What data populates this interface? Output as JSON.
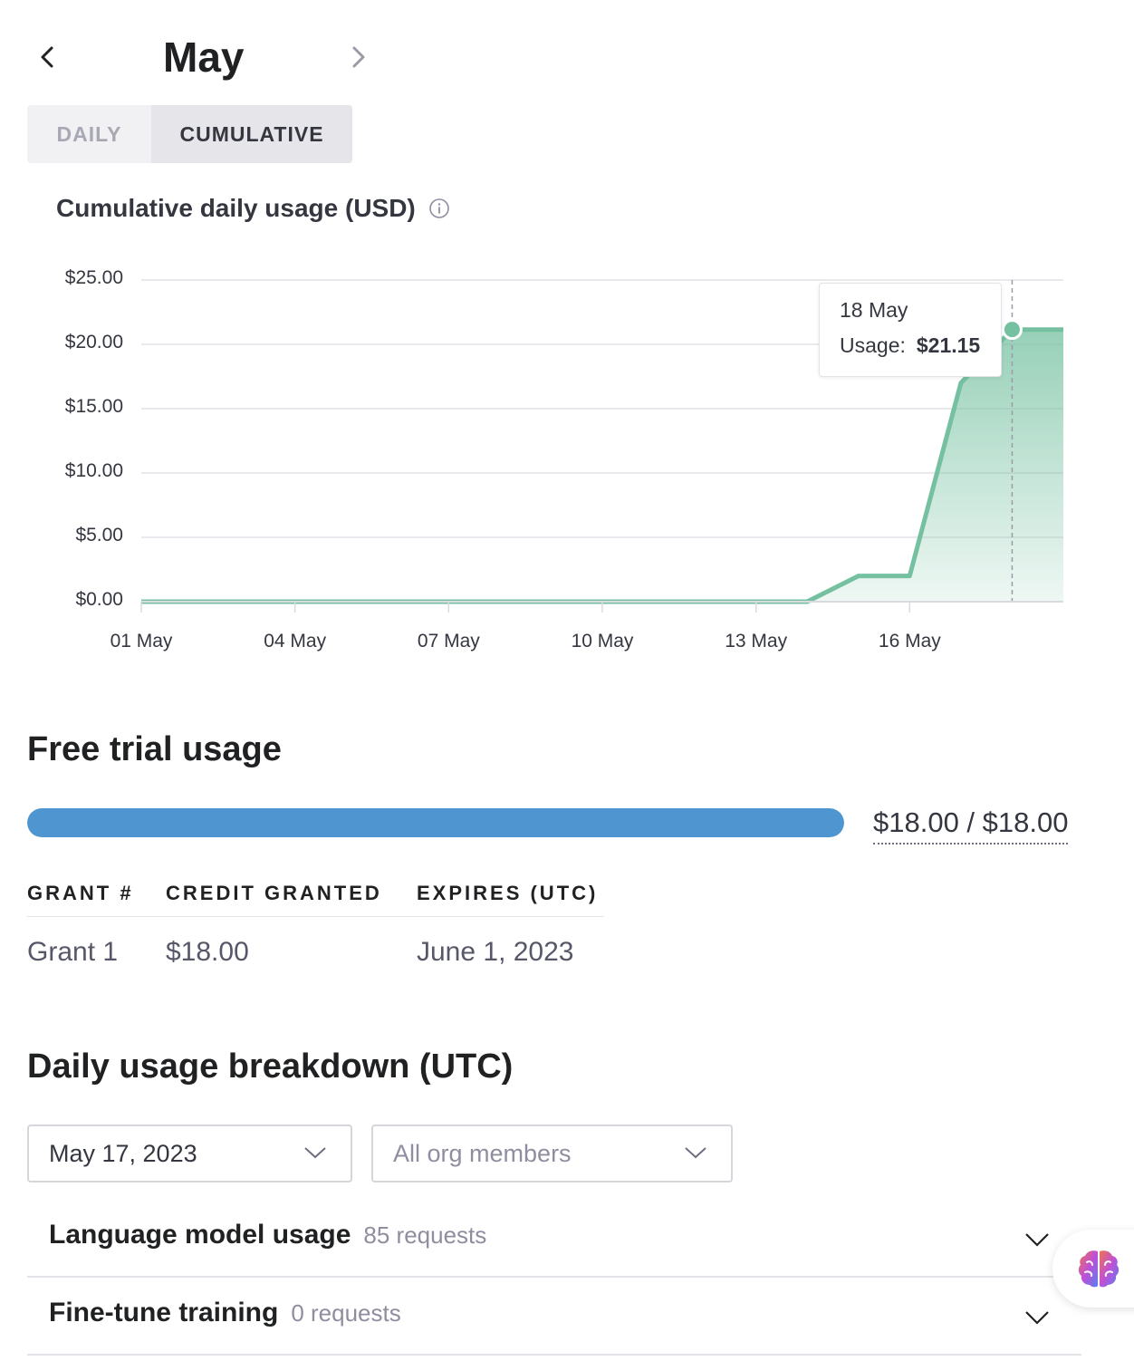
{
  "header": {
    "month": "May",
    "prev_icon": "chevron-left-icon",
    "next_icon": "chevron-right-icon"
  },
  "view_toggle": {
    "options": [
      "DAILY",
      "CUMULATIVE"
    ],
    "selected": "CUMULATIVE"
  },
  "chart": {
    "title": "Cumulative daily usage (USD)",
    "info_icon": "info-icon",
    "tooltip": {
      "date": "18 May",
      "label": "Usage:",
      "value": "$21.15"
    }
  },
  "chart_data": {
    "type": "area",
    "title": "Cumulative daily usage (USD)",
    "xlabel": "",
    "ylabel": "",
    "x": [
      1,
      2,
      3,
      4,
      5,
      6,
      7,
      8,
      9,
      10,
      11,
      12,
      13,
      14,
      15,
      16,
      17,
      18,
      19
    ],
    "series": [
      {
        "values": [
          0,
          0,
          0,
          0,
          0,
          0,
          0,
          0,
          0,
          0,
          0,
          0,
          0,
          0,
          2.0,
          2.0,
          17.0,
          21.15,
          21.15
        ]
      }
    ],
    "x_tick_values": [
      1,
      4,
      7,
      10,
      13,
      16
    ],
    "x_tick_labels": [
      "01 May",
      "04 May",
      "07 May",
      "10 May",
      "13 May",
      "16 May"
    ],
    "y_tick_labels": [
      "$0.00",
      "$5.00",
      "$10.00",
      "$15.00",
      "$20.00",
      "$25.00"
    ],
    "y_tick_values": [
      0,
      5,
      10,
      15,
      20,
      25
    ],
    "ylim": [
      0,
      25
    ],
    "xlim": [
      1,
      19
    ],
    "grid": true,
    "highlight": {
      "x": 18,
      "y": 21.15
    },
    "color": "#74c0a0"
  },
  "free_trial": {
    "title": "Free trial usage",
    "used": 18.0,
    "total": 18.0,
    "progress_fraction": 1.0,
    "progress_text": "$18.00 / $18.00",
    "bar_color": "#4f96d0"
  },
  "grants": {
    "headers": [
      "GRANT #",
      "CREDIT GRANTED",
      "EXPIRES (UTC)"
    ],
    "rows": [
      [
        "Grant 1",
        "$18.00",
        "June 1, 2023"
      ]
    ]
  },
  "breakdown": {
    "title": "Daily usage breakdown (UTC)",
    "date_select": "May 17, 2023",
    "member_select_placeholder": "All org members",
    "sections": [
      {
        "title": "Language model usage",
        "count": "85 requests"
      },
      {
        "title": "Fine-tune training",
        "count": "0 requests"
      }
    ]
  },
  "floating_button": {
    "icon": "brain-icon"
  }
}
